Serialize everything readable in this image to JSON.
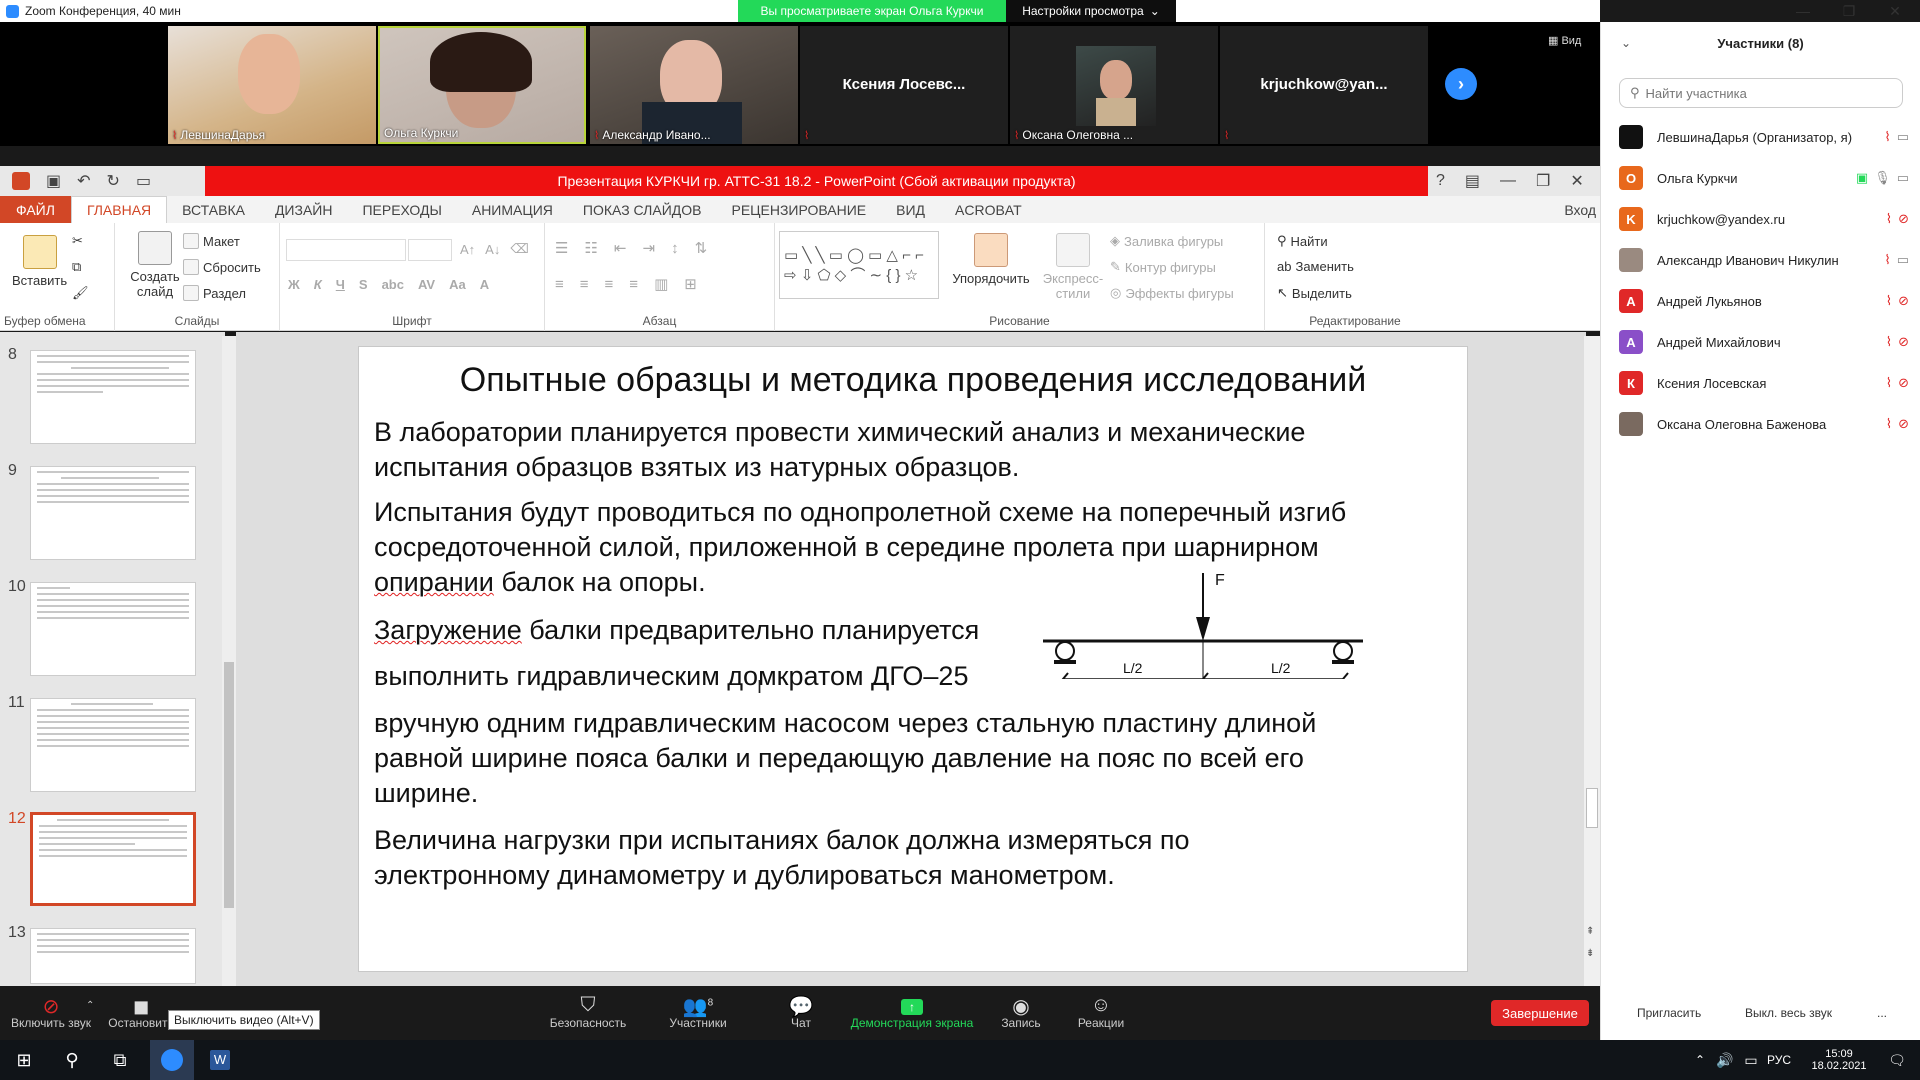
{
  "zoom": {
    "title": "Zoom Конференция, 40 мин",
    "share_banner": "Вы просматриваете экран Ольга Куркчи",
    "view_options": "Настройки просмотра",
    "view_button": "Вид",
    "video_tiles": [
      {
        "name": "ЛевшинаДарья",
        "muted": true
      },
      {
        "name": "Ольга Куркчи",
        "muted": false
      },
      {
        "name": "Александр Ивано...",
        "muted": true
      },
      {
        "name": "Ксения  Лосевс...",
        "muted": true
      },
      {
        "name": "Оксана Олеговна ...",
        "muted": true
      },
      {
        "name": "krjuchkow@yan...",
        "muted": true
      }
    ],
    "toolbar": {
      "unmute": "Включить звук",
      "stop_video": "Остановить",
      "stop_video_tooltip": "Выключить видео (Alt+V)",
      "security": "Безопасность",
      "participants": "Участники",
      "participants_count": "8",
      "chat": "Чат",
      "share": "Демонстрация экрана",
      "record": "Запись",
      "reactions": "Реакции",
      "end": "Завершение"
    },
    "panel": {
      "title": "Участники (8)",
      "search_placeholder": "Найти участника",
      "participants": [
        {
          "name": "ЛевшинаДарья (Организатор, я)",
          "initial": "",
          "color": "#111111"
        },
        {
          "name": "Ольга Куркчи",
          "initial": "О",
          "color": "#e8681c"
        },
        {
          "name": "krjuchkow@yandex.ru",
          "initial": "K",
          "color": "#e8681c"
        },
        {
          "name": "Александр Иванович Никулин",
          "initial": "",
          "color": "#9a8a80"
        },
        {
          "name": "Андрей Лукьянов",
          "initial": "А",
          "color": "#e02828"
        },
        {
          "name": "Андрей Михайлович",
          "initial": "А",
          "color": "#8a4fc8"
        },
        {
          "name": "Ксения Лосевская",
          "initial": "К",
          "color": "#e02828"
        },
        {
          "name": "Оксана Олеговна Баженова",
          "initial": "",
          "color": "#7a6a60"
        }
      ],
      "invite": "Пригласить",
      "mute_all": "Выкл. весь звук",
      "more": "..."
    }
  },
  "ppt": {
    "window_title": "Презентация КУРКЧИ гр. АТТС-31 18.2 -  PowerPoint (Сбой активации продукта)",
    "tabs": [
      "ФАЙЛ",
      "ГЛАВНАЯ",
      "ВСТАВКА",
      "ДИЗАЙН",
      "ПЕРЕХОДЫ",
      "АНИМАЦИЯ",
      "ПОКАЗ СЛАЙДОВ",
      "РЕЦЕНЗИРОВАНИЕ",
      "ВИД",
      "ACROBAT"
    ],
    "signin": "Вход",
    "ribbon": {
      "paste": "Вставить",
      "clipboard": "Буфер обмена",
      "new_slide": "Создать слайд",
      "layout": "Макет",
      "reset": "Сбросить",
      "section": "Раздел",
      "slides": "Слайды",
      "font": "Шрифт",
      "paragraph": "Абзац",
      "arrange": "Упорядочить",
      "quick_styles": "Экспресс-стили",
      "shape_fill": "Заливка фигуры",
      "shape_outline": "Контур фигуры",
      "shape_effects": "Эффекты фигуры",
      "drawing": "Рисование",
      "find": "Найти",
      "replace": "Заменить",
      "select": "Выделить",
      "editing": "Редактирование"
    },
    "thumb_numbers": [
      "8",
      "9",
      "10",
      "11",
      "12",
      "13"
    ],
    "selected_slide": "12",
    "slide": {
      "title": "Опытные образцы и методика проведения исследований",
      "p1": [
        "В лаборатории планируется провести химический анализ и механические",
        "испытания образцов взятых из натурных образцов."
      ],
      "p2": [
        "Испытания будут проводиться по однопролетной схеме на поперечный изгиб",
        "сосредоточенной силой, приложенной в середине пролета при шарнирном"
      ],
      "p2_squig": "опирании",
      "p2_rest": " балок на опоры.",
      "p3_squig": "Загружение",
      "p3_rest": " балки предварительно планируется",
      "p4": "выполнить гидравлическим домкратом ДГО–25",
      "p5": [
        "вручную одним гидравлическим насосом через стальную пластину длиной",
        "равной ширине пояса балки и передающую давление на пояс по всей его",
        "ширине."
      ],
      "p6": [
        "Величина нагрузки при испытаниях балок должна измеряться по",
        "электронному динамометру и дублироваться манометром."
      ],
      "diagram": {
        "force": "F",
        "left_span": "L/2",
        "right_span": "L/2"
      }
    }
  },
  "taskbar": {
    "lang": "РУС",
    "time": "15:09",
    "date": "18.02.2021"
  }
}
